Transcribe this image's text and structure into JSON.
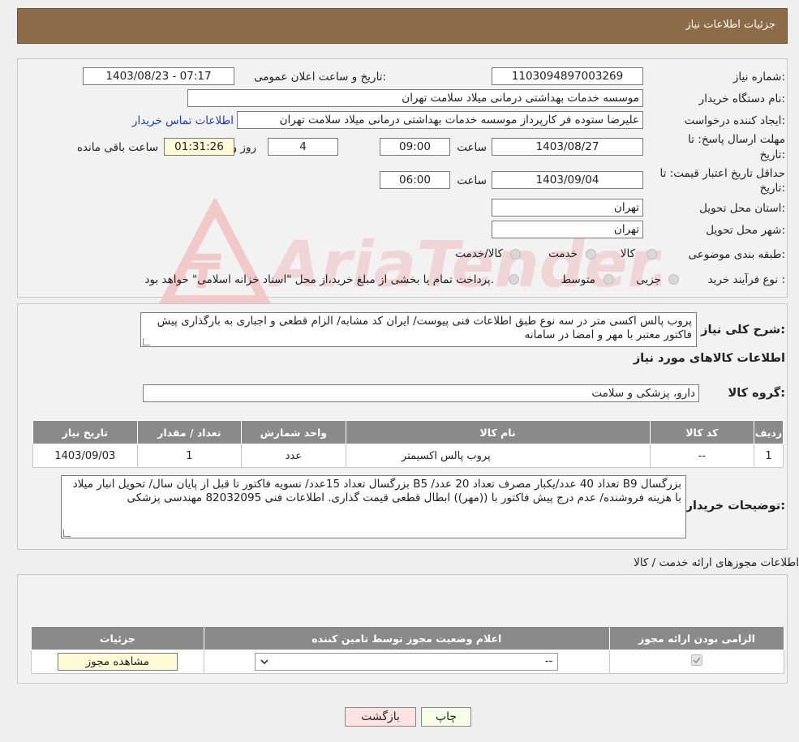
{
  "header": {
    "title": "جزئیات اطلاعات نیاز"
  },
  "watermark": {
    "text": "AriaTender.neT"
  },
  "form": {
    "need_number_label": "شماره نیاز:",
    "need_number": "1103094897003269",
    "announce_label": "تاریخ و ساعت اعلان عمومی:",
    "announce_value": "1403/08/23 - 07:17",
    "buyer_label": "نام دستگاه خریدار:",
    "buyer_value": "موسسه خدمات بهداشتی درمانی میلاد سلامت تهران",
    "creator_label": "ایجاد کننده درخواست:",
    "creator_value": "علیرضا ستوده فر کارپرداز موسسه خدمات بهداشتی درمانی میلاد سلامت تهران",
    "contact_link": "اطلاعات تماس خریدار",
    "deadline_label_1": "مهلت ارسال پاسخ: تا",
    "deadline_label_2": "تاریخ:",
    "deadline_date": "1403/08/27",
    "time_label": "ساعت",
    "deadline_time": "09:00",
    "days_value": "4",
    "days_label": "روز و",
    "remaining_time": "01:31:26",
    "remaining_label": "ساعت باقی مانده",
    "validity_label_1": "حداقل تاریخ اعتبار قیمت: تا",
    "validity_label_2": "تاریخ:",
    "validity_date": "1403/09/04",
    "validity_time": "06:00",
    "province_label": "استان محل تحویل:",
    "province_value": "تهران",
    "city_label": "شهر محل تحویل:",
    "city_value": "تهران",
    "category_label": "طبقه بندی موضوعی:",
    "category_options": [
      "کالا",
      "خدمت",
      "کالا/خدمت"
    ],
    "process_label": "نوع فرآیند خرید :",
    "process_options": [
      "جزیی",
      "متوسط"
    ],
    "process_note": "پرداخت تمام یا بخشی از مبلغ خرید،از محل \"اسناد خزانه اسلامی\" خواهد بود."
  },
  "summary": {
    "label": "شرح کلی نیاز:",
    "text": "پروب پالس اکسی متر در سه نوع طبق اطلاعات فنی پیوست/ ایران  کد مشابه/ الزام قطعی و اجباری به بارگذاری پیش فاکتور معتبر با مهر و امضا در سامانه",
    "goods_info_title": "اطلاعات کالاهای مورد نیاز",
    "group_label": "گروه کالا:",
    "group_value": "دارو، پزشکی و سلامت"
  },
  "goods_table": {
    "headers": [
      "ردیف",
      "کد کالا",
      "نام کالا",
      "واحد شمارش",
      "تعداد / مقدار",
      "تاریخ نیاز"
    ],
    "rows": [
      [
        "1",
        "--",
        "پروب پالس اکسیمتر",
        "عدد",
        "1",
        "1403/09/03"
      ]
    ]
  },
  "buyer_notes": {
    "label": "توضیحات خریدار:",
    "text": "بزرگسال B9 تعداد 40 عدد/یکبار مصرف تعداد 20 عدد/ B5 بزرگسال تعداد 15عدد/ تسویه فاکتور تا قبل از پایان سال/ تحویل انبار میلاد با هزینه فروشنده/ عدم درج پیش فاکتور با ((مهر)) ابطال قطعی قیمت گذاری. اطلاعات فنی 82032095 مهندسی پزشکی"
  },
  "permits": {
    "title": "اطلاعات مجوزهای ارائه خدمت / کالا",
    "headers": [
      "الزامی بودن ارائه مجوز",
      "اعلام وضعیت مجوز توسط تامین کننده",
      "جزئیات"
    ],
    "select_value": "--",
    "view_button": "مشاهده مجوز"
  },
  "actions": {
    "print": "چاپ",
    "back": "بازگشت"
  }
}
